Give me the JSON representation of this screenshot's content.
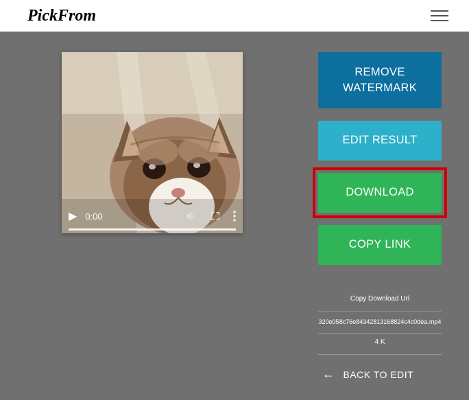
{
  "header": {
    "logo": "PickFrom"
  },
  "video": {
    "time": "0:00"
  },
  "actions": {
    "remove_label": "REMOVE WATERMARK",
    "edit_label": "EDIT RESULT",
    "download_label": "DOWNLOAD",
    "copy_label": "COPY LINK"
  },
  "info": {
    "copy_url_label": "Copy Download Url",
    "filename": "320e058c76e84342813168824c4c0dea.mp4",
    "filesize": "4 K",
    "back_label": "BACK TO EDIT"
  }
}
